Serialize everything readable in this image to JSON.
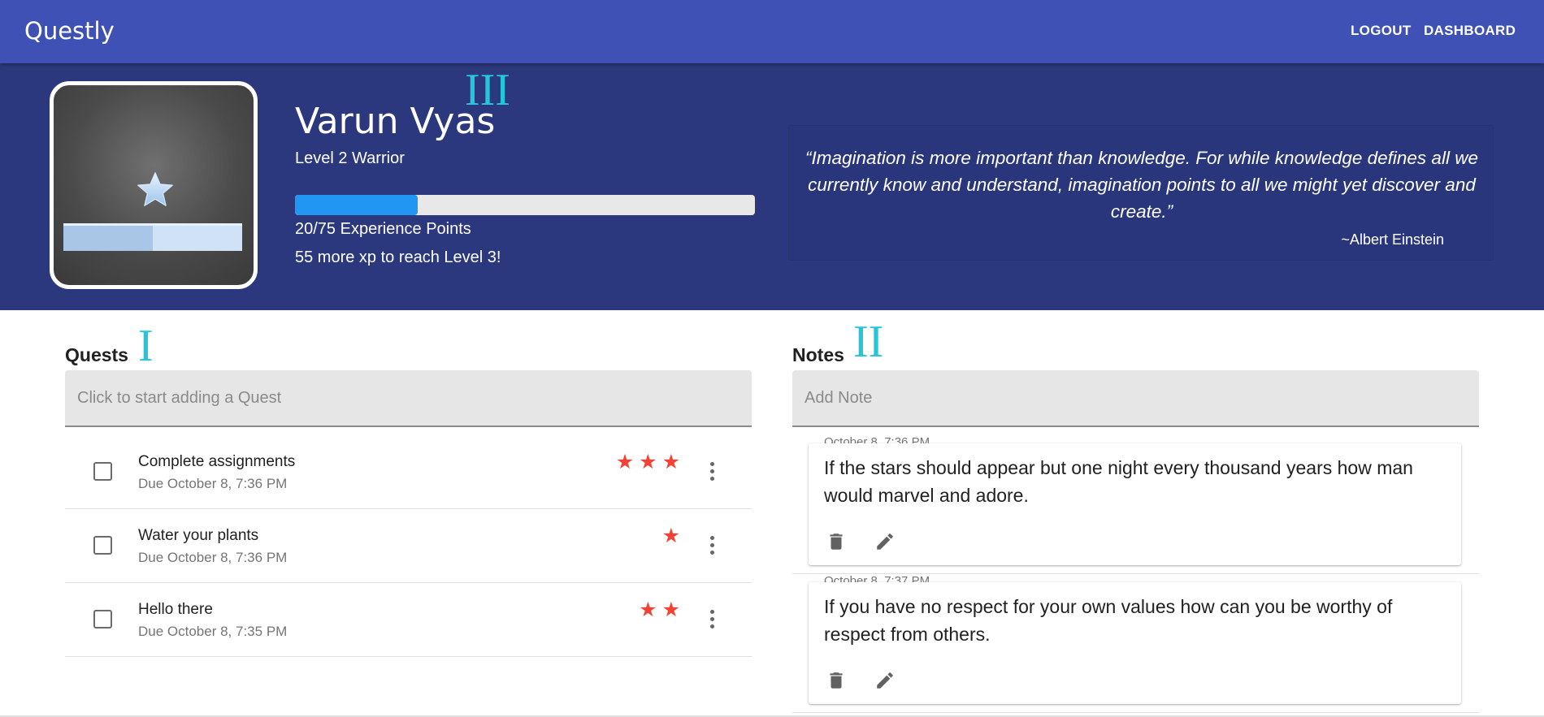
{
  "app": {
    "title": "Questly"
  },
  "nav": {
    "logout": "LOGOUT",
    "dashboard": "DASHBOARD"
  },
  "profile": {
    "name": "Varun Vyas",
    "level": "Level 2 Warrior",
    "xp_text": "20/75 Experience Points",
    "xp_remaining": "55 more xp to reach Level 3!",
    "xp_progress": 0.267,
    "avatar_progress": 0.5
  },
  "quote": {
    "text": "“Imagination is more important than knowledge. For while knowledge defines all we currently know and understand, imagination points to all we might yet discover and create.”",
    "author": "~Albert Einstein"
  },
  "annotations": {
    "hero": "III",
    "quests": "I",
    "notes": "II"
  },
  "quests": {
    "title": "Quests",
    "placeholder": "Click to start adding a Quest",
    "items": [
      {
        "title": "Complete assignments",
        "due": "Due October 8, 7:36 PM",
        "stars": "★★★",
        "difficulty": 3
      },
      {
        "title": "Water your plants",
        "due": "Due October 8, 7:36 PM",
        "stars": "★",
        "difficulty": 1
      },
      {
        "title": "Hello there",
        "due": "Due October 8, 7:35 PM",
        "stars": "★★",
        "difficulty": 2
      }
    ]
  },
  "notes": {
    "title": "Notes",
    "placeholder": "Add Note",
    "items": [
      {
        "date": "October 8, 7:36 PM",
        "text": "If the stars should appear but one night every thousand years how man would marvel and adore."
      },
      {
        "date": "October 8, 7:37 PM",
        "text": "If you have no respect for your own values how can you be worthy of respect from others."
      }
    ]
  },
  "colors": {
    "primary": "#3f51b5",
    "hero_bg": "#2c387e",
    "accent": "#2196f3",
    "star": "#f44336",
    "annotation": "#26c6da"
  },
  "icons": {
    "checkbox": "checkbox-outline-icon",
    "more": "more-vert-icon",
    "delete": "trash-icon",
    "edit": "pencil-icon",
    "avatar": "star-icon"
  }
}
